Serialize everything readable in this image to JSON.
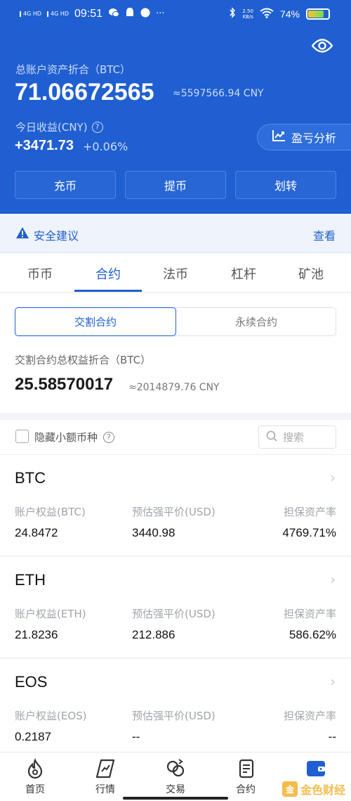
{
  "status_bar": {
    "signal1": "4G HD",
    "signal2": "4G HD",
    "time": "09:51",
    "more": "···",
    "net_speed_value": "2.50",
    "net_speed_unit": "KB/s",
    "battery_pct": "74%",
    "battery_level": 0.74
  },
  "header": {
    "total_label": "总账户资产折合（BTC）",
    "total_value": "71.06672565",
    "total_cny": "≈5597566.94 CNY",
    "today_label": "今日收益(CNY)",
    "today_value": "+3471.73",
    "today_pct": "+0.06%",
    "pl_button": "盈亏分析",
    "actions": [
      "充币",
      "提币",
      "划转"
    ]
  },
  "banner": {
    "title": "安全建议",
    "view": "查看"
  },
  "tabs": {
    "items": [
      "币币",
      "合约",
      "法币",
      "杠杆",
      "矿池"
    ],
    "active": "合约"
  },
  "contract": {
    "seg_active": "交割合约",
    "seg_inactive": "永续合约",
    "equity_label": "交割合约总权益折合（BTC）",
    "equity_value": "25.58570017",
    "equity_cny": "≈2014879.76 CNY"
  },
  "filter": {
    "hide_small": "隐藏小额币种",
    "search_placeholder": "搜索"
  },
  "coins": [
    {
      "symbol": "BTC",
      "equity_label": "账户权益(BTC)",
      "equity": "24.8472",
      "liq_label": "预估强平价(USD)",
      "liq": "3440.98",
      "margin_label": "担保资产率",
      "margin": "4769.71%"
    },
    {
      "symbol": "ETH",
      "equity_label": "账户权益(ETH)",
      "equity": "21.8236",
      "liq_label": "预估强平价(USD)",
      "liq": "212.886",
      "margin_label": "担保资产率",
      "margin": "586.62%"
    },
    {
      "symbol": "EOS",
      "equity_label": "账户权益(EOS)",
      "equity": "0.2187",
      "liq_label": "预估强平价(USD)",
      "liq": "--",
      "margin_label": "担保资产率",
      "margin": "--"
    }
  ],
  "bottom_nav": {
    "items": [
      "首页",
      "行情",
      "交易",
      "合约",
      ""
    ],
    "active_index": 4
  },
  "watermark": "金色财经",
  "colors": {
    "brand_blue": "#1f5fd1",
    "banner_bg": "#eef3fc",
    "muted": "#a0a4ab"
  }
}
